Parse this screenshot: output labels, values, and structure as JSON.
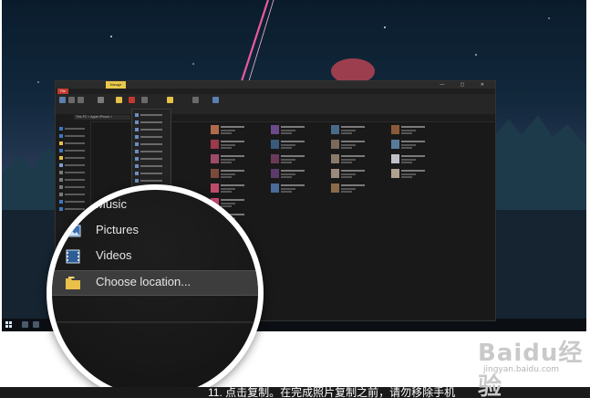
{
  "window": {
    "ribbon_context_tab": "Manage",
    "file_tab": "File",
    "address": "This PC > Apple iPhone >"
  },
  "zoomed_menu": {
    "items": [
      {
        "label": "Music",
        "icon": "music-icon"
      },
      {
        "label": "Pictures",
        "icon": "pictures-icon"
      },
      {
        "label": "Videos",
        "icon": "videos-icon"
      },
      {
        "label": "Choose location...",
        "icon": "folder-icon",
        "selected": true
      }
    ]
  },
  "caption": "11. 点击复制。在完成照片复制之前，请勿移除手机",
  "watermark": {
    "logo": "Baidu经验",
    "url": "jingyan.baidu.com"
  },
  "colors": {
    "manage_tab": "#e9c84a",
    "file_tab": "#c23a2e",
    "folder": "#e8c04a",
    "selection": "#3d3d3d"
  }
}
